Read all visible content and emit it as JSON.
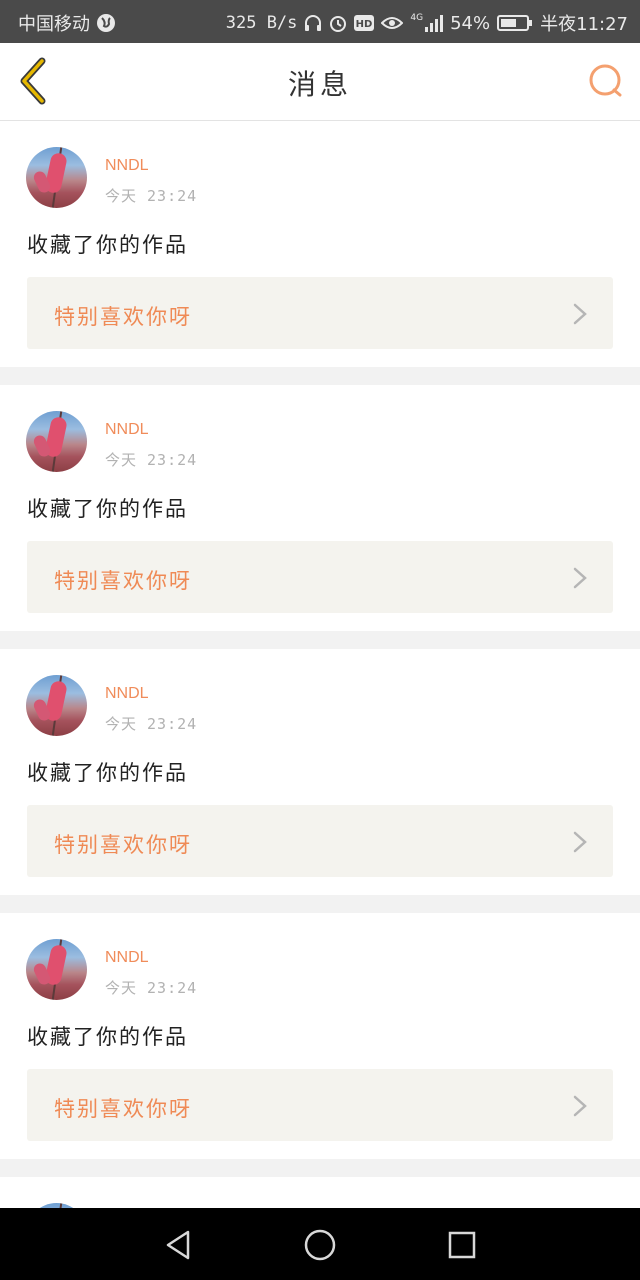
{
  "status_bar": {
    "carrier": "中国移动",
    "network_speed": "325 B/s",
    "signal_label": "4G",
    "battery": "54%",
    "time": "半夜11:27"
  },
  "header": {
    "title": "消息",
    "back_icon": "chevron-left-icon",
    "search_icon": "search-icon"
  },
  "colors": {
    "accent": "#f08c5a",
    "back_arrow": "#e6b800",
    "quote_bg": "#f4f3ee"
  },
  "messages": [
    {
      "username": "NNDL",
      "time": "今天 23:24",
      "action": "收藏了你的作品",
      "quote": "特别喜欢你呀"
    },
    {
      "username": "NNDL",
      "time": "今天 23:24",
      "action": "收藏了你的作品",
      "quote": "特别喜欢你呀"
    },
    {
      "username": "NNDL",
      "time": "今天 23:24",
      "action": "收藏了你的作品",
      "quote": "特别喜欢你呀"
    },
    {
      "username": "NNDL",
      "time": "今天 23:24",
      "action": "收藏了你的作品",
      "quote": "特别喜欢你呀"
    }
  ],
  "system_nav": {
    "back_icon": "triangle-back-icon",
    "home_icon": "circle-home-icon",
    "recents_icon": "square-recents-icon"
  }
}
